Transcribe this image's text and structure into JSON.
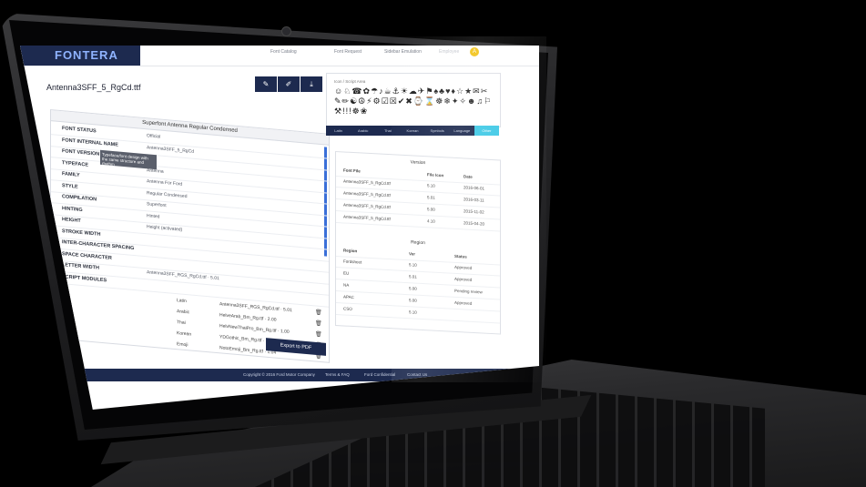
{
  "header": {
    "logo": "FONTERA",
    "nav": [
      "Font Catalog",
      "Font Request",
      "Sidebar Emulation",
      "Employee"
    ],
    "notification_badge": "A"
  },
  "file": {
    "name": "Antenna3SFF_5_RgCd.ttf",
    "actions": [
      "edit-icon",
      "pen-icon",
      "download-icon"
    ]
  },
  "details": {
    "title": "Superfont Antenna Regular Condensed",
    "rows": [
      {
        "label": "Font Status",
        "value": "Official"
      },
      {
        "label": "Font Internal Name",
        "value": "Antenna3SFF_5_RgCd"
      },
      {
        "label": "Font Version",
        "value": "5.10"
      },
      {
        "label": "Typeface",
        "value": "Antenna"
      },
      {
        "label": "Family",
        "value": "Antenna For Ford"
      },
      {
        "label": "Style",
        "value": "Regular Condensed"
      },
      {
        "label": "Compilation",
        "value": "Superfont"
      },
      {
        "label": "Hinting",
        "value": "Hinted"
      },
      {
        "label": "Height",
        "value": "Height (activated)"
      },
      {
        "label": "Stroke Width",
        "value": ""
      },
      {
        "label": "Inter-Character Spacing",
        "value": ""
      },
      {
        "label": "Space Character",
        "value": ""
      },
      {
        "label": "Letter Width",
        "value": "Antenna3SFF_RGS_RgCd.ttf · 5.01"
      },
      {
        "label": "Script Modules",
        "value": ""
      }
    ],
    "tooltip": "Typeface/font design with the same structure and rhythm",
    "scripts": [
      {
        "lang": "Latin",
        "file": "Antenna3SFF_RGS_RgCd.ttf · 5.01"
      },
      {
        "lang": "Arabic",
        "file": "HelveArab_Bm_Rg.ttf · 2.00"
      },
      {
        "lang": "Thai",
        "file": "HelvNewThaiPro_Bm_Rg.ttf · 1.00"
      },
      {
        "lang": "Korean",
        "file": "YDGothic_Bm_Rg.ttf · 1.005"
      },
      {
        "lang": "Emoji",
        "file": "NotoEmoji_Bm_Rg.ttf · 1.04"
      }
    ],
    "export_label": "Export to PDF"
  },
  "glyphs": {
    "title": "Icon / Script Area",
    "chars": "☺♘☎✿☂♪☕⚓☀☁✈⚑♠♣♥♦☆★✉✂✎✏☯☮⚡⚙☑☒✔✖⌚⌛☸❄✦✧☻♫⚐⚒!!!☸❀",
    "tabs": [
      "Latin",
      "Arabic",
      "Thai",
      "Korean",
      "Symbols",
      "Language",
      "Other"
    ],
    "active_tab": 6
  },
  "versions": {
    "title": "Version",
    "columns": [
      "Font File",
      "File Icon",
      "Date"
    ],
    "rows": [
      {
        "file": "Antenna3SFF_5_RgCd.ttf",
        "version": "5.10",
        "date": "2016-06-01"
      },
      {
        "file": "Antenna3SFF_5_RgCd.ttf",
        "version": "5.01",
        "date": "2016-03-11"
      },
      {
        "file": "Antenna3SFF_5_RgCd.ttf",
        "version": "5.00",
        "date": "2015-11-02"
      },
      {
        "file": "Antenna3SFF_5_RgCd.ttf",
        "version": "4.10",
        "date": "2015-04-20"
      }
    ]
  },
  "regions": {
    "title": "Region",
    "columns": [
      "Region",
      "Ver",
      "Status"
    ],
    "rows": [
      {
        "region": "Fordsheet",
        "ver": "5.10",
        "status": "Approved"
      },
      {
        "region": "EU",
        "ver": "5.01",
        "status": "Approved"
      },
      {
        "region": "NA",
        "ver": "5.00",
        "status": "Pending review"
      },
      {
        "region": "APAC",
        "ver": "5.00",
        "status": "Approved"
      },
      {
        "region": "CSO",
        "ver": "5.10",
        "status": ""
      }
    ]
  },
  "footer": [
    "Copyright © 2016 Ford Motor Company",
    "Terms & FAQ",
    "Ford Confidential",
    "Contact Us"
  ]
}
